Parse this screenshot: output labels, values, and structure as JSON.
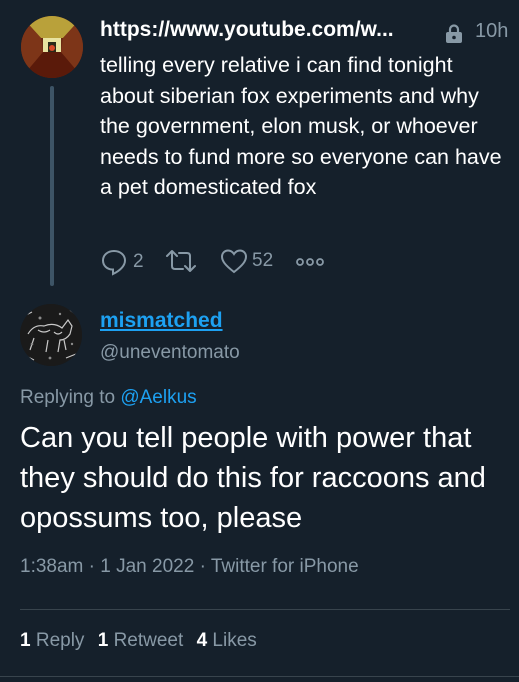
{
  "parent_tweet": {
    "link": "https://www.youtube.com/w...",
    "time": "10h",
    "text": "telling every relative i can find tonight about siberian fox experiments and why the government, elon musk, or whoever needs to fund more so everyone can have a pet domesticated fox",
    "replies": "2",
    "likes": "52"
  },
  "reply_tweet": {
    "display_name": "mismatched",
    "handle": "@uneventomato",
    "replying_prefix": "Replying to",
    "replying_to": "@Aelkus",
    "text": "Can you tell people with power that they should do this for raccoons and opossums too, please",
    "meta": "1:38am · 1 Jan 2022 · Twitter for iPhone",
    "stats": {
      "replies_count": "1",
      "replies_label": "Reply",
      "retweets_count": "1",
      "retweets_label": "Retweet",
      "likes_count": "4",
      "likes_label": "Likes"
    }
  },
  "colors": {
    "background": "#15202b",
    "accent": "#1da1f2",
    "muted": "#8899a6"
  }
}
